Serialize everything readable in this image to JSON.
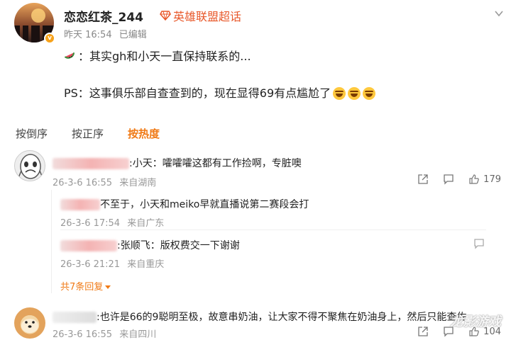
{
  "post": {
    "username": "恋恋红茶_244",
    "superchat": "英雄联盟超话",
    "time": "昨天 16:54",
    "edited": "已编辑",
    "line1": "：其实gh和小天一直保持联系的...",
    "line2": "PS：这事俱乐部自查查到的，现在显得69有点尴尬了"
  },
  "sort": {
    "tabs": [
      "按倒序",
      "按正序",
      "按热度"
    ],
    "active_index": 2
  },
  "comments": [
    {
      "text": ":小天：嚯嚯嚯这都有工作捡啊，专脏噢",
      "time": "26-3-6 16:55",
      "location": "来自湖南",
      "likes": "179",
      "replies": [
        {
          "text": "不至于，小天和meiko早就直播说第二赛段会打",
          "time": "26-3-6 17:54",
          "location": "来自广东"
        },
        {
          "text": ":张顺飞：版权费交一下谢谢",
          "time": "26-3-6 21:21",
          "location": "来自重庆"
        }
      ],
      "total_replies": "共7条回复"
    },
    {
      "text": ":也许是66的9聪明至极，故意串奶油，让大家不得不聚焦在奶油身上，然后只能查佐",
      "time": "26-3-6 16:55",
      "location": "来自四川",
      "likes": "104"
    }
  ],
  "watermark": "龙影游戏",
  "colors": {
    "accent": "#f07a16",
    "superchat": "#e8582a"
  },
  "icons": [
    "melon-icon",
    "laugh-emoji",
    "share-icon",
    "comment-icon",
    "like-icon",
    "more-icon",
    "diamond-icon"
  ]
}
